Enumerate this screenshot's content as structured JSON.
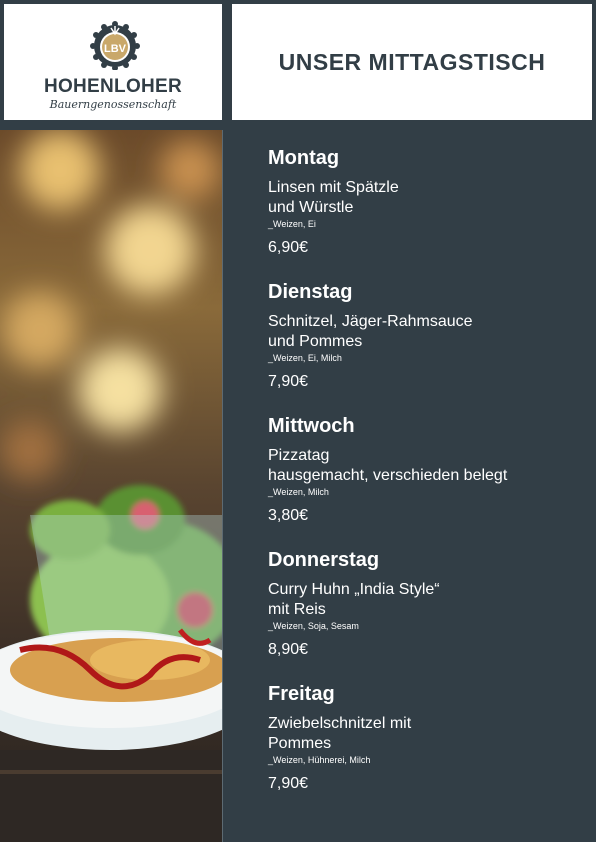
{
  "logo": {
    "badge_text": "LBV",
    "name": "HOHENLOHER",
    "subtitle": "Bauerngenossenschaft"
  },
  "header": {
    "title": "UNSER MITTAGSTISCH"
  },
  "photo": {
    "icon": "salad-photo"
  },
  "menu": [
    {
      "day": "Montag",
      "dish": "Linsen mit Spätzle\nund Würstle",
      "allergens": "_Weizen, Ei",
      "price": "6,90€"
    },
    {
      "day": "Dienstag",
      "dish": "Schnitzel, Jäger-Rahmsauce\nund Pommes",
      "allergens": "_Weizen, Ei, Milch",
      "price": "7,90€"
    },
    {
      "day": "Mittwoch",
      "dish": "Pizzatag\nhausgemacht, verschieden belegt",
      "allergens": "_Weizen, Milch",
      "price": "3,80€"
    },
    {
      "day": "Donnerstag",
      "dish": "Curry Huhn „India Style“\nmit Reis",
      "allergens": "_Weizen, Soja, Sesam",
      "price": "8,90€"
    },
    {
      "day": "Freitag",
      "dish": "Zwiebelschnitzel mit\nPommes",
      "allergens": "_Weizen, Hühnerei, Milch",
      "price": "7,90€"
    }
  ]
}
